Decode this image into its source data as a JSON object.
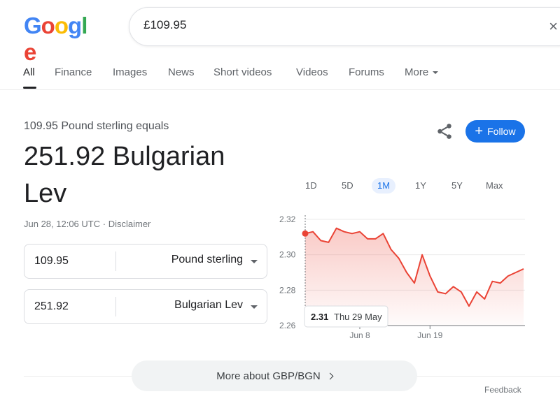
{
  "header": {
    "logo_letters": [
      "G",
      "o",
      "o",
      "g",
      "l",
      "e"
    ],
    "logo_colors": [
      "#4285f4",
      "#ea4335",
      "#fbbc05",
      "#4285f4",
      "#34a853",
      "#ea4335"
    ],
    "search_value": "£109.95",
    "search_close": "×"
  },
  "tabs": {
    "items": [
      "All",
      "Finance",
      "Images",
      "News",
      "Short videos",
      "Videos",
      "Forums",
      "More"
    ],
    "active": "All"
  },
  "result": {
    "equals_label": "109.95 Pound sterling equals",
    "value": "251.92 Bulgarian Lev",
    "timestamp": "Jun 28, 12:06 UTC",
    "separator": "·",
    "disclaimer": "Disclaimer"
  },
  "actions": {
    "follow_label": "Follow",
    "follow_plus": "+",
    "accent_color": "#1a73e8"
  },
  "converter": {
    "from": {
      "amount": "109.95",
      "currency": "Pound sterling"
    },
    "to": {
      "amount": "251.92",
      "currency": "Bulgarian Lev"
    }
  },
  "ranges": {
    "items": [
      "1D",
      "5D",
      "1M",
      "1Y",
      "5Y",
      "Max"
    ],
    "active": "1M"
  },
  "chart_data": {
    "type": "area",
    "title": "",
    "xlabel": "",
    "ylabel": "",
    "ylim": [
      2.26,
      2.32
    ],
    "yticks": [
      "2.32",
      "2.30",
      "2.28",
      "2.26"
    ],
    "xticks": [
      "Jun 8",
      "Jun 19"
    ],
    "line_color": "#ea4335",
    "series": [
      {
        "values": [
          2.312,
          2.313,
          2.308,
          2.307,
          2.315,
          2.313,
          2.312,
          2.313,
          2.309,
          2.309,
          2.312,
          2.303,
          2.298,
          2.29,
          2.284,
          2.3,
          2.288,
          2.279,
          2.278,
          2.282,
          2.279,
          2.271,
          2.279,
          2.275,
          2.285,
          2.284,
          2.288,
          2.29,
          2.292
        ]
      }
    ],
    "tooltip": {
      "value": "2.31",
      "date": "Thu 29 May"
    }
  },
  "bottom": {
    "more_about": "More about GBP/BGN",
    "feedback": "Feedback"
  }
}
